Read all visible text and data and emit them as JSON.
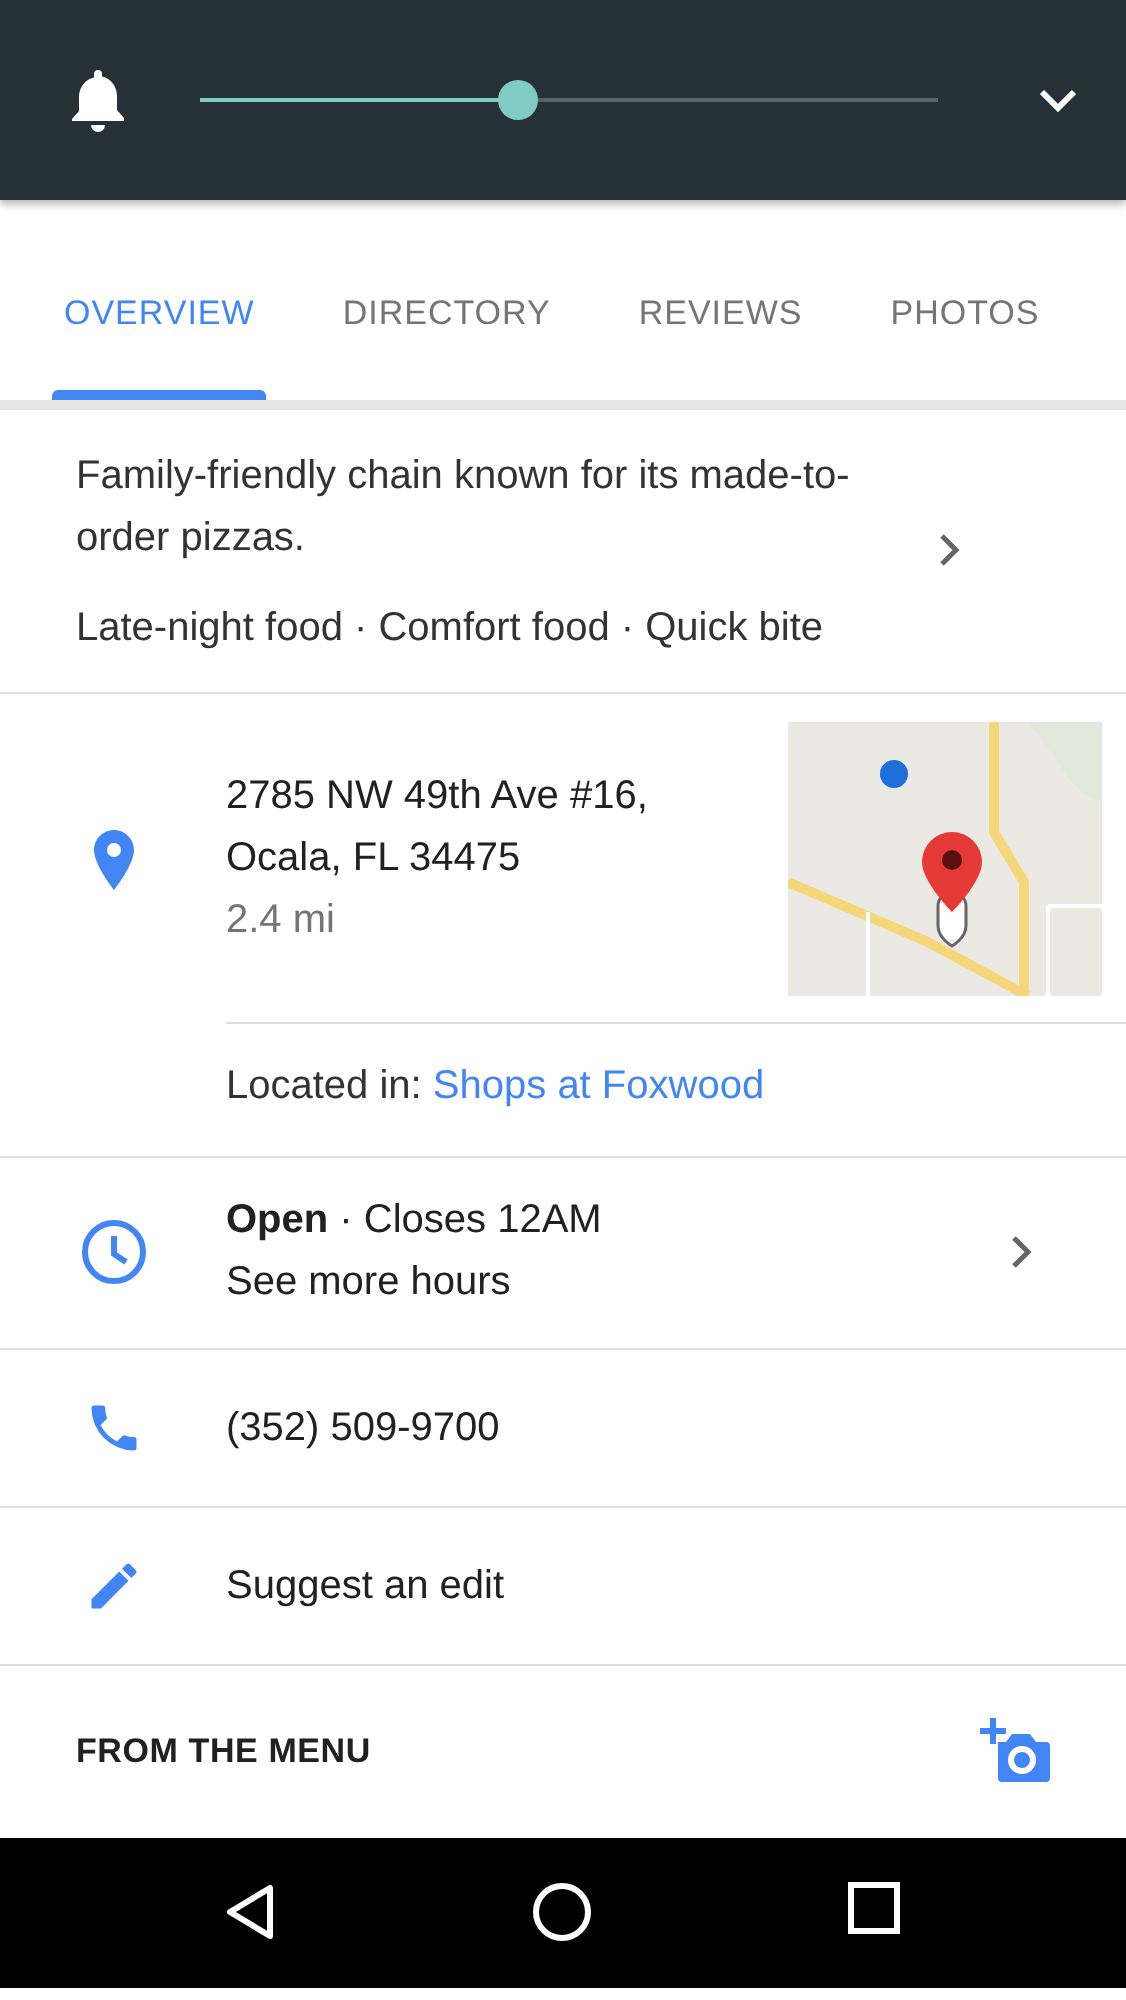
{
  "header": {
    "volume": {
      "level": 0.43
    }
  },
  "tabs": [
    {
      "label": "OVERVIEW",
      "selected": true
    },
    {
      "label": "DIRECTORY",
      "selected": false
    },
    {
      "label": "REVIEWS",
      "selected": false
    },
    {
      "label": "PHOTOS",
      "selected": false
    }
  ],
  "description": {
    "text": "Family-friendly chain known for its made-to-order pizzas.",
    "tags": "Late-night food · Comfort food · Quick bite"
  },
  "address": {
    "lines": [
      "2785 NW 49th Ave #16,",
      "Ocala, FL 34475"
    ],
    "distance": "2.4 mi",
    "located_in": {
      "label": "Located in:",
      "place": "Shops at Foxwood"
    }
  },
  "hours": {
    "status": "**Open** · Closes 12AM",
    "more": "See more hours"
  },
  "phone": "(352) 509-9700",
  "suggest_edit": "Suggest an edit",
  "menu_section": {
    "title": "FROM THE MENU"
  }
}
